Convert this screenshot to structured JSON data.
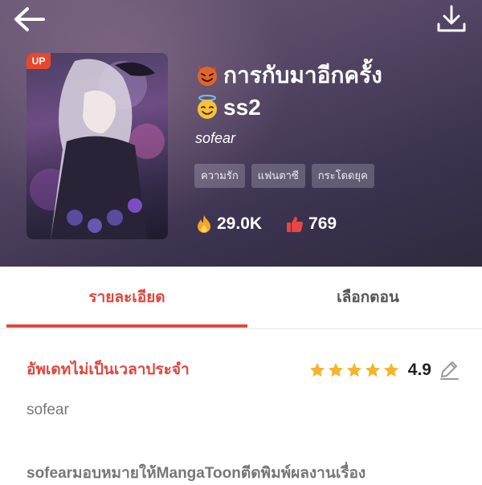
{
  "header": {
    "title_line1": "การกับมาอีกครั้ง",
    "title_line2": "ss2",
    "author": "sofear",
    "up_badge": "UP",
    "tags": [
      "ความรัก",
      "แฟนตาซี",
      "กระโดดยุค"
    ],
    "views": "29.0K",
    "likes": "769"
  },
  "tabs": {
    "details": "รายละเอียด",
    "episodes": "เลือกตอน"
  },
  "info": {
    "update_status": "อัพเดทไม่เป็นเวลาประจำ",
    "rating_value": "4.9",
    "rating_stars": 5,
    "author": "sofear",
    "description": "sofearมอบหมายให้MangaToonตีดพิมพ์ผลงานเรื่อง"
  },
  "colors": {
    "accent": "#e0463e",
    "star": "#f6b32b"
  },
  "icons": [
    "back-arrow-icon",
    "download-icon",
    "devil-emoji-icon",
    "angel-emoji-icon",
    "fire-icon",
    "thumbs-up-icon",
    "star-icon",
    "edit-pencil-icon"
  ]
}
